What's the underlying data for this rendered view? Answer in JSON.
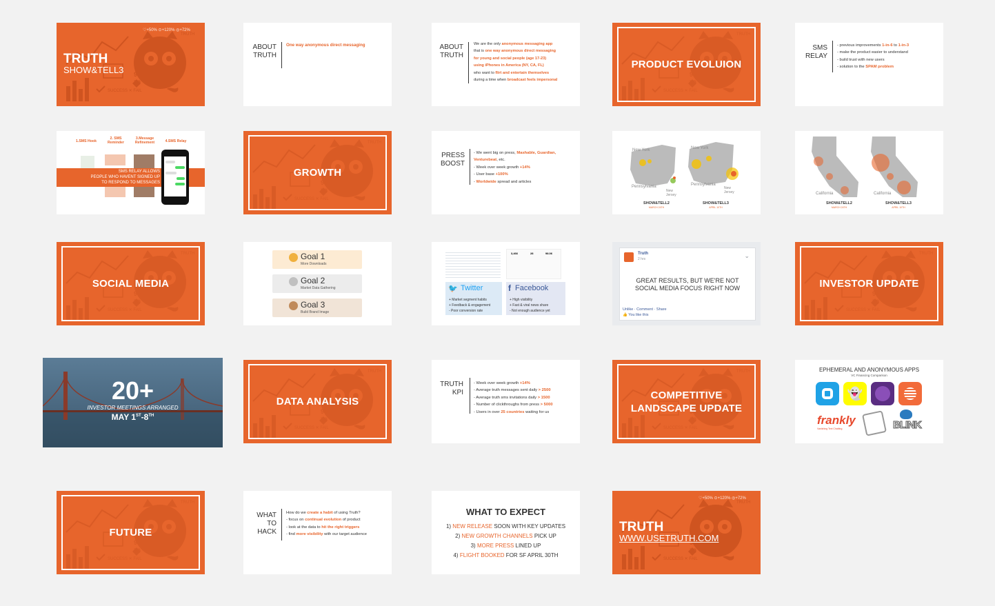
{
  "colors": {
    "accent": "#e7652c",
    "background": "#f2f2f2",
    "slide": "#ffffff"
  },
  "s01": {
    "title": "TRUTH",
    "subtitle": "SHOW&TELL3"
  },
  "s02": {
    "label_line1": "ABOUT",
    "label_line2": "TRUTH",
    "body": "One way anonymous direct messaging"
  },
  "s03": {
    "label_line1": "ABOUT",
    "label_line2": "TRUTH",
    "l1a": "We are the only ",
    "l1b": "anonymous messaging app",
    "l2a": "that is ",
    "l2b": "one way anonymous direct messaging",
    "l3": "for young and social people (age 17-23)",
    "l4": "using iPhones in America (NY, CA, FL)",
    "l5a": "who want to ",
    "l5b": "flirt and entertain themselves",
    "l6a": "during a time when ",
    "l6b": "broadcast feels impersonal"
  },
  "s04": {
    "title": "PRODUCT EVOLUION"
  },
  "s05": {
    "label_line1": "SMS",
    "label_line2": "RELAY",
    "l1a": "- previous improvements ",
    "l1b": "1-in-6",
    " l1c": " to ",
    "l1d": "1-in-3",
    "l2": "- make the product easier to understand",
    "l3": "- build trust with new users",
    "l4a": "- solution to the ",
    "l4b": "SPAM problem"
  },
  "s06": {
    "h1": "1.SMS Hook",
    "h2": "2. SMS Reminder",
    "h3": "3.Message Refinement",
    "h4": "4.SMS Relay",
    "banner_l1": "SMS RELAY ALLOWS",
    "banner_l2": "PEOPLE WHO HAVENT SIGNED UP",
    "banner_l3": "TO RESPOND TO MESSAGES"
  },
  "s07": {
    "title": "GROWTH"
  },
  "s08": {
    "label_line1": "PRESS",
    "label_line2": "BOOST",
    "l1a": "- We went big on press, ",
    "l1b": "Mashable, Guardian,",
    "l2": "Venturebeat",
    "l2c": ", etc.",
    "l3a": "- Week over week growth ",
    "l3b": "+14%",
    "l4a": "- User base ",
    "l4b": "+100%",
    "l5a": "- ",
    "l5b": "Worldwide",
    " l5c": " spread and articles"
  },
  "s09": {
    "left_caption": "SHOW&TELL2",
    "left_date": "MARCH 24TH",
    "right_caption": "SHOW&TELL3",
    "right_date": "APRIL 10TH",
    "map_ny": "New York",
    "map_pa": "Pennsylvania",
    "map_nj": "New Jersey"
  },
  "s10": {
    "left_caption": "SHOW&TELL2",
    "left_date": "MARCH 24TH",
    "right_caption": "SHOW&TELL3",
    "right_date": "APRIL 10TH",
    "map_ca": "California"
  },
  "s11": {
    "title": "SOCIAL MEDIA"
  },
  "s12": {
    "goals": [
      {
        "title": "Goal 1",
        "sub": "More Downloads"
      },
      {
        "title": "Goal 2",
        "sub": "Market Data Gathering"
      },
      {
        "title": "Goal 3",
        "sub": "Build Brand Image"
      }
    ]
  },
  "s13": {
    "twitter": "Twitter",
    "facebook": "Facebook",
    "tw1": "+ Market segment habits",
    "tw2": "+ Feedback & engagement",
    "tw3": "- Poor conversion rate",
    "fb1": "+ High visibility",
    "fb2": "+ Fast & viral news share",
    "fb3": "- Not enough audience yet",
    "stat1": "3,466",
    "stat2": "28",
    "stat3": "98.06"
  },
  "s14": {
    "page": "Truth",
    "time": "2 hrs",
    "msg_l1": "GREAT RESULTS, BUT WE'RE NOT",
    "msg_l2": "SOCIAL MEDIA FOCUS RIGHT NOW",
    "actions": "Unlike · Comment · Share",
    "likes": "You like this"
  },
  "s15": {
    "title": "INVESTOR UPDATE"
  },
  "s16": {
    "number": "20+",
    "line": "INVESTOR MEETINGS ARRANGED",
    "date": "MAY 1",
    "sup1": "ST",
    "dash": "-8",
    "sup2": "TH"
  },
  "s17": {
    "title": "DATA ANALYSIS"
  },
  "s18": {
    "label_line1": "TRUTH",
    "label_line2": "KPI",
    "l1a": "- Week over week growth ",
    "l1b": "+14%",
    "l2a": "- Average truth messages sent daily ",
    "l2b": "> 2500",
    "l3a": "- Average truth sms invitations daily ",
    "l3b": "> 1500",
    "l4a": "- Number of clickthroughs from press ",
    "l4b": "> 5000",
    "l5a": "- Users in over ",
    "l5b": "25 countries",
    " l5c": " waiting for us"
  },
  "s19": {
    "title": "COMPETITIVE LANDSCAPE UPDATE"
  },
  "s20": {
    "title": "EPHEMERAL AND ANONYMOUS APPS",
    "subtitle": "VC Financing Comparison",
    "frankly": "frankly",
    "frankly_sub": "Vanishing Text Chatting",
    "blink": "BLINK"
  },
  "s21": {
    "title": "FUTURE"
  },
  "s22": {
    "label_line1": "WHAT",
    "label_line2": "TO HACK",
    "l1a": "How do we ",
    "l1b": "create a habit",
    " l1c": " of using Truth?",
    "l2a": "- focus on ",
    "l2b": "continual evolution",
    " l2c": " of product",
    "l3a": "- look at the data to ",
    "l3b": "hit the right triggers",
    "l4a": "- find ",
    "l4b": "more visibility",
    " l4c": " with our target audience"
  },
  "s23": {
    "title": "WHAT TO EXPECT",
    "items": [
      {
        "n": "1) ",
        "o": "NEW RELEASE",
        "t": " SOON WITH KEY UPDATES"
      },
      {
        "n": "2) ",
        "o": "NEW GROWTH CHANNELS",
        "t": " PICK UP"
      },
      {
        "n": "3) ",
        "o": "MORE PRESS",
        "t": " LINED UP"
      },
      {
        "n": "4) ",
        "o": "FLIGHT BOOKED",
        "t": " FOR SF APRIL 30TH"
      }
    ]
  },
  "s24": {
    "title": "TRUTH",
    "url": "WWW.USETRUTH.COM"
  }
}
